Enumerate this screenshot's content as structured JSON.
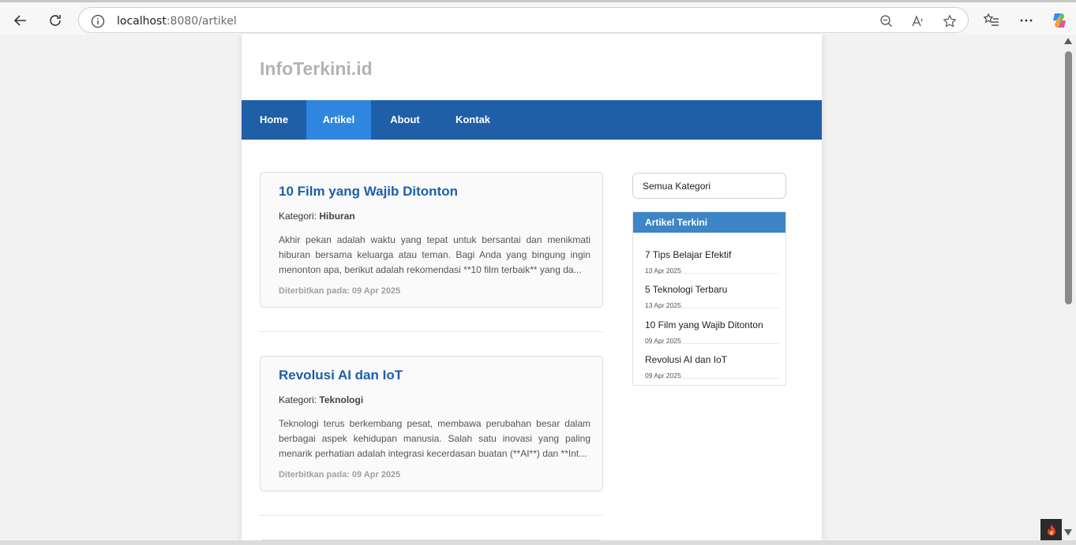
{
  "browser": {
    "url_host": "localhost",
    "url_path": ":8080/artikel"
  },
  "site": {
    "logo": "InfoTerkini.id",
    "nav": [
      {
        "label": "Home"
      },
      {
        "label": "Artikel"
      },
      {
        "label": "About"
      },
      {
        "label": "Kontak"
      }
    ]
  },
  "articles": [
    {
      "title": "10 Film yang Wajib Ditonton",
      "category_label": "Kategori:",
      "category": "Hiburan",
      "excerpt": "Akhir pekan adalah waktu yang tepat untuk bersantai dan menikmati hiburan bersama keluarga atau teman. Bagi Anda yang bingung ingin menonton apa, berikut adalah rekomendasi **10 film terbaik** yang da...",
      "published": "Diterbitkan pada: 09 Apr 2025"
    },
    {
      "title": "Revolusi AI dan IoT",
      "category_label": "Kategori:",
      "category": "Teknologi",
      "excerpt": "Teknologi terus berkembang pesat, membawa perubahan besar dalam berbagai aspek kehidupan manusia. Salah satu inovasi yang paling menarik perhatian adalah integrasi kecerdasan buatan (**AI**) dan **Int...",
      "published": "Diterbitkan pada: 09 Apr 2025"
    }
  ],
  "sidebar": {
    "category_select": "Semua Kategori",
    "recent_title": "Artikel Terkini",
    "recent": [
      {
        "title": "7 Tips Belajar Efektif",
        "date": "13 Apr 2025"
      },
      {
        "title": "5 Teknologi Terbaru",
        "date": "13 Apr 2025"
      },
      {
        "title": "10 Film yang Wajib Ditonton",
        "date": "09 Apr 2025"
      },
      {
        "title": "Revolusi AI dan IoT",
        "date": "09 Apr 2025"
      }
    ]
  },
  "colors": {
    "navbar": "#1f5fa8",
    "nav_active": "#2e86de",
    "link": "#1f5fa8",
    "sidebar_head": "#3d85c6"
  }
}
